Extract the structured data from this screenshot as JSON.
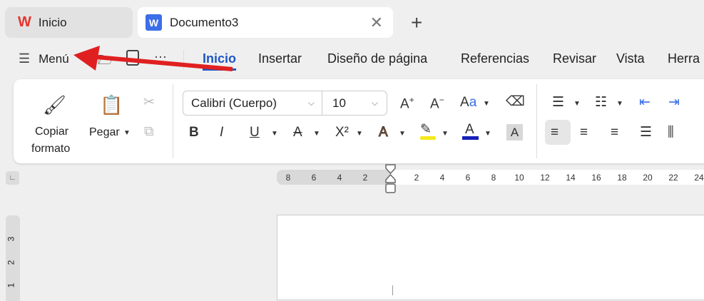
{
  "tabs": [
    {
      "label": "Inicio",
      "icon": "wps-logo-icon"
    },
    {
      "label": "Documento3",
      "icon": "word-doc-icon",
      "logo_letter": "W"
    }
  ],
  "menu": {
    "label": "Menú"
  },
  "ribbon_tabs": [
    "Inicio",
    "Insertar",
    "Diseño de página",
    "Referencias",
    "Revisar",
    "Vista",
    "Herra"
  ],
  "active_tab": "Inicio",
  "clipboard": {
    "format_painter": [
      "Copiar",
      "formato"
    ],
    "paste": "Pegar"
  },
  "font": {
    "name": "Calibri (Cuerpo)",
    "size": "10"
  },
  "ruler": {
    "left": [
      "8",
      "6",
      "4",
      "2"
    ],
    "right": [
      "2",
      "4",
      "6",
      "8",
      "10",
      "12",
      "14",
      "16",
      "18",
      "20",
      "22",
      "24"
    ],
    "vertical": [
      "3",
      "2",
      "1"
    ]
  },
  "colors": {
    "accent": "#1e56c4",
    "highlight": "#f5ea1a",
    "font_color": "#1620b8",
    "arrow": "#e02020"
  }
}
